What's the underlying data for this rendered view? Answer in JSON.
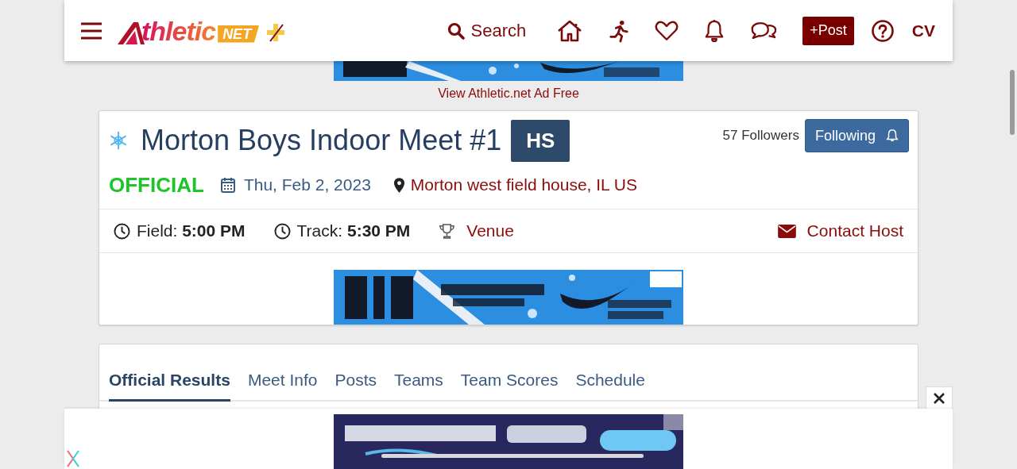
{
  "header": {
    "logo": {
      "word": "thletic",
      "badge": "NET"
    },
    "search_label": "Search",
    "post_button": "+Post",
    "user_initials": "CV"
  },
  "ad_free_link": "View Athletic.net Ad Free",
  "meet": {
    "title": "Morton Boys Indoor Meet #1",
    "level_badge": "HS",
    "followers": "57 Followers",
    "follow_button": "Following",
    "status": {
      "kind": "official",
      "label": "OFFICIAL"
    },
    "date": "Thu, Feb 2, 2023",
    "location": "Morton west field house, IL US",
    "times": [
      "Field: **5:00 PM**",
      "Track: **5:30 PM**"
    ],
    "venue_link": "Venue",
    "contact_link": "Contact Host"
  },
  "tabs": [
    {
      "label": "Official Results",
      "selected": true
    },
    {
      "label": "Meet Info",
      "selected": false
    },
    {
      "label": "Posts",
      "selected": false
    },
    {
      "label": "Teams",
      "selected": false
    },
    {
      "label": "Team Scores",
      "selected": false
    },
    {
      "label": "Schedule",
      "selected": false
    }
  ]
}
